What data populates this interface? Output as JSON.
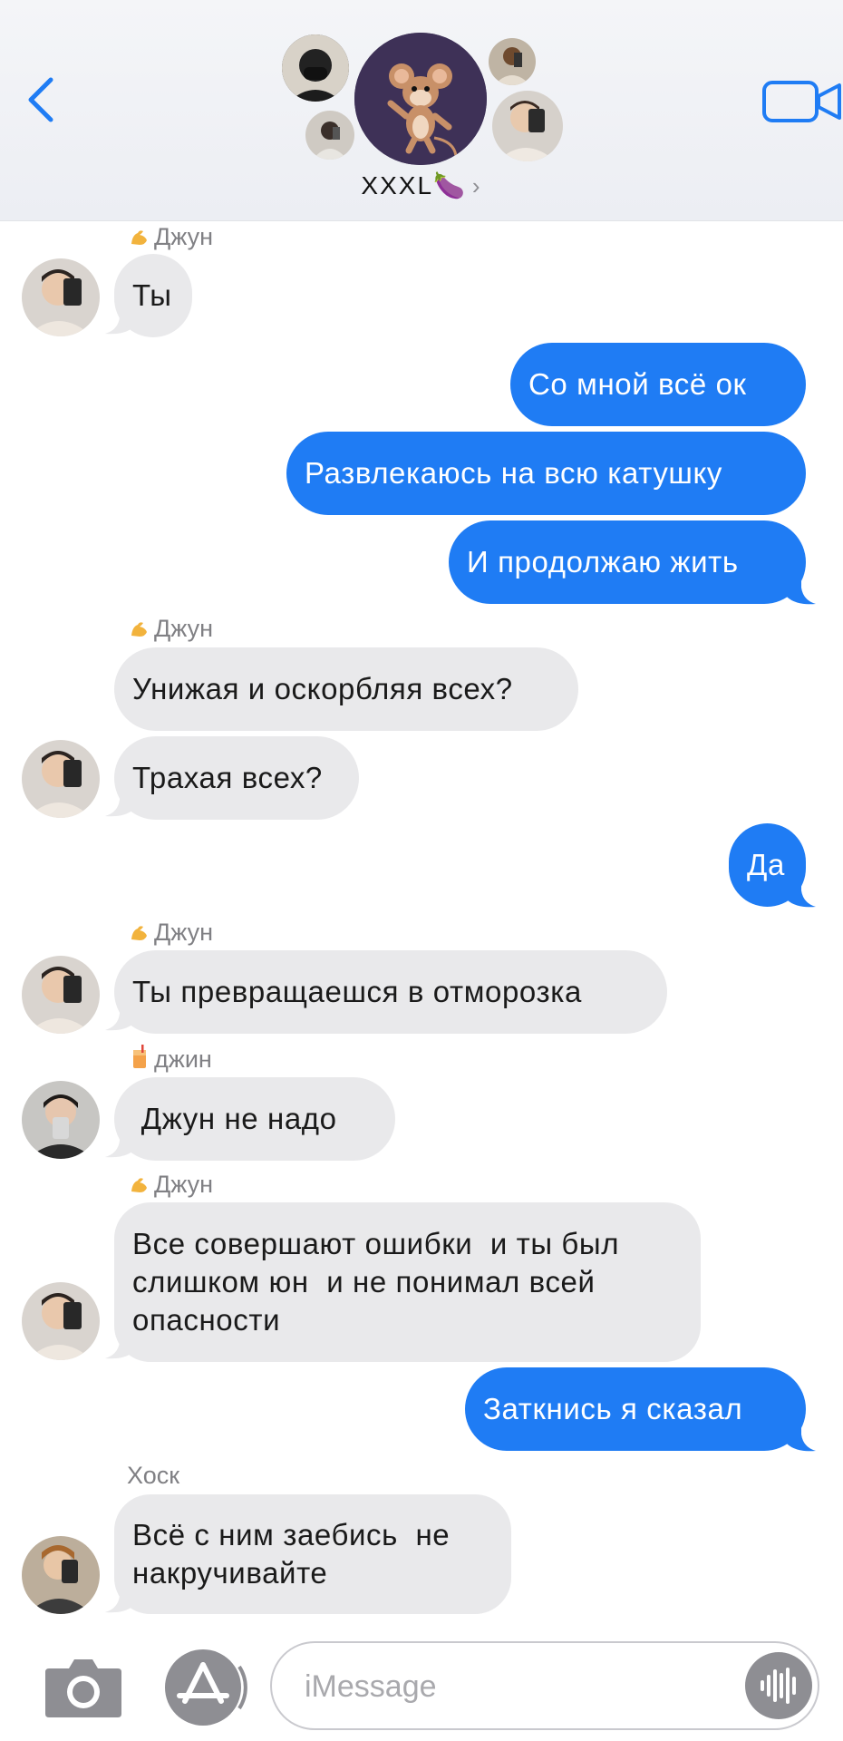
{
  "header": {
    "group_name": "XXXL",
    "group_emoji": "🍆",
    "group_chevron": "›"
  },
  "composer": {
    "placeholder": "iMessage"
  },
  "messages": [
    {
      "sender": "Джун",
      "text": "Ты",
      "direction": "incoming"
    },
    {
      "text": "Со мной всё ок",
      "direction": "outgoing"
    },
    {
      "text": "Развлекаюсь на всю катушку",
      "direction": "outgoing"
    },
    {
      "text": "И продолжаю жить",
      "direction": "outgoing"
    },
    {
      "sender": "Джун",
      "text": "Унижая и оскорбляя всех?",
      "direction": "incoming"
    },
    {
      "text": "Трахая всех?",
      "direction": "incoming"
    },
    {
      "text": "Да",
      "direction": "outgoing"
    },
    {
      "sender": "Джун",
      "text": "Ты превращаешся в отморозка",
      "direction": "incoming"
    },
    {
      "sender": "джин",
      "text": " Джун не надо",
      "direction": "incoming"
    },
    {
      "sender": "Джун",
      "text": "Все совершают ошибки  и ты был\nслишком юн  и не понимал всей\nопасности",
      "direction": "incoming"
    },
    {
      "text": "Заткнись я сказал",
      "direction": "outgoing"
    },
    {
      "sender": "Хоск",
      "text": "Всё с ним заебись  не\nнакручивайте",
      "direction": "incoming"
    }
  ],
  "icons": {
    "back": "chevron-left-icon",
    "video": "video-camera-icon",
    "camera": "camera-icon",
    "apps": "app-store-icon",
    "audio": "audio-waveform-icon"
  },
  "colors": {
    "outgoing_bubble": "#1f7cf4",
    "incoming_bubble": "#e9e9eb",
    "accent": "#1f7cf4",
    "sender_label": "#808084"
  }
}
